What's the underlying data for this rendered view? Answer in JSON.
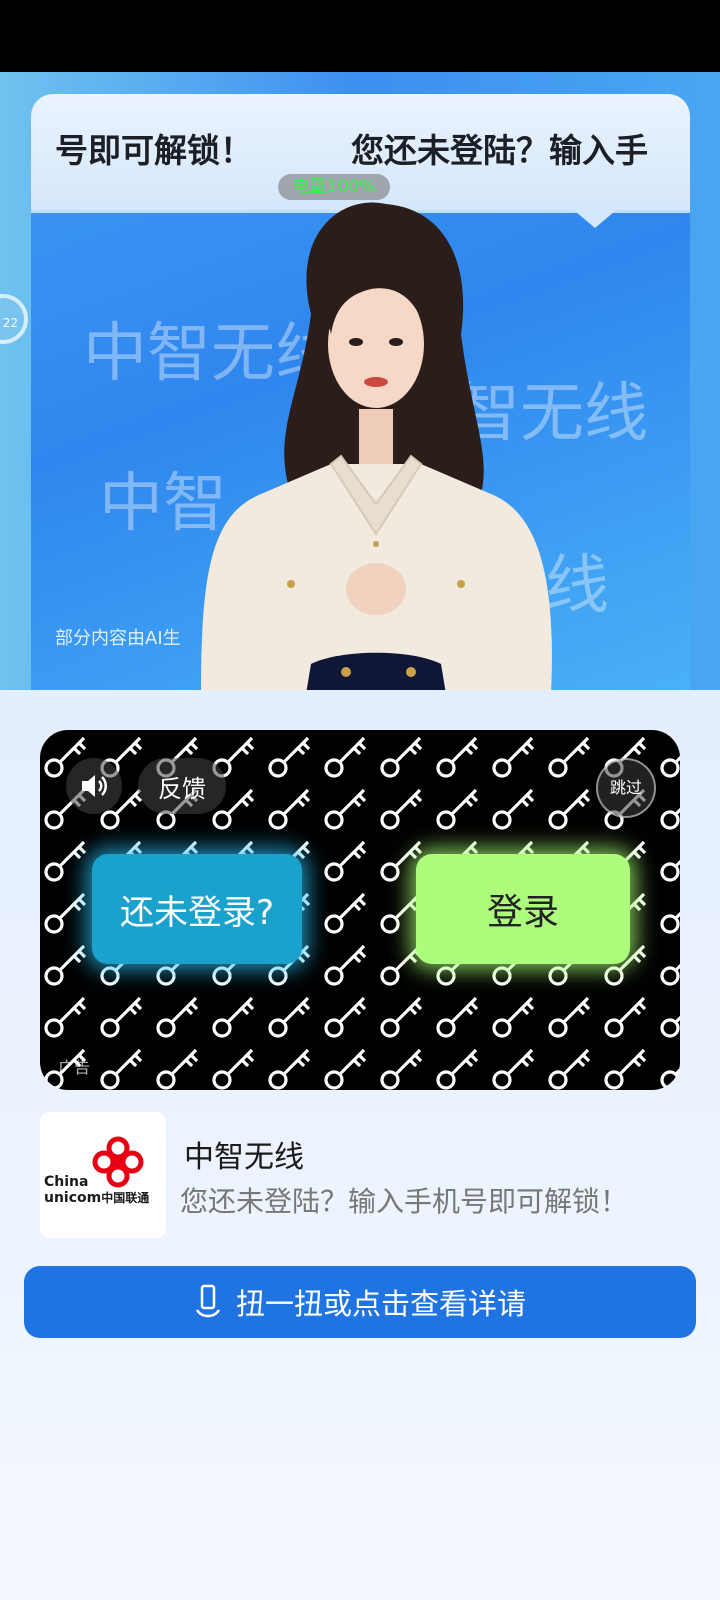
{
  "video": {
    "marquee_left": "号即可解锁！",
    "marquee_right": "您还未登陆？输入手",
    "watermark_text": "中智无线",
    "watermark_partial_1": "中智",
    "watermark_partial_2": "智无线",
    "watermark_partial_3": "无线",
    "battery_badge": "电量100%",
    "ai_note": "部分内容由AI生",
    "side_timer": "22"
  },
  "ad": {
    "feedback_label": "反馈",
    "skip_label": "跳过",
    "not_logged_label": "还未登录?",
    "login_label": "登录",
    "ad_label": "广告"
  },
  "advertiser": {
    "name": "中智无线",
    "description": "您还未登陆？输入手机号即可解锁！",
    "logo_text_en_1": "China",
    "logo_text_en_2": "unicom",
    "logo_text_cn": "中国联通"
  },
  "cta": {
    "label": "扭一扭或点击查看详请"
  },
  "colors": {
    "cta_blue": "#1f74e2",
    "login_green": "#aefc7c",
    "not_logged_cyan": "#1ba2cc",
    "unicom_red": "#e60012"
  },
  "icons": [
    "speaker-icon",
    "phone-shake-icon",
    "key-pattern-icon"
  ]
}
